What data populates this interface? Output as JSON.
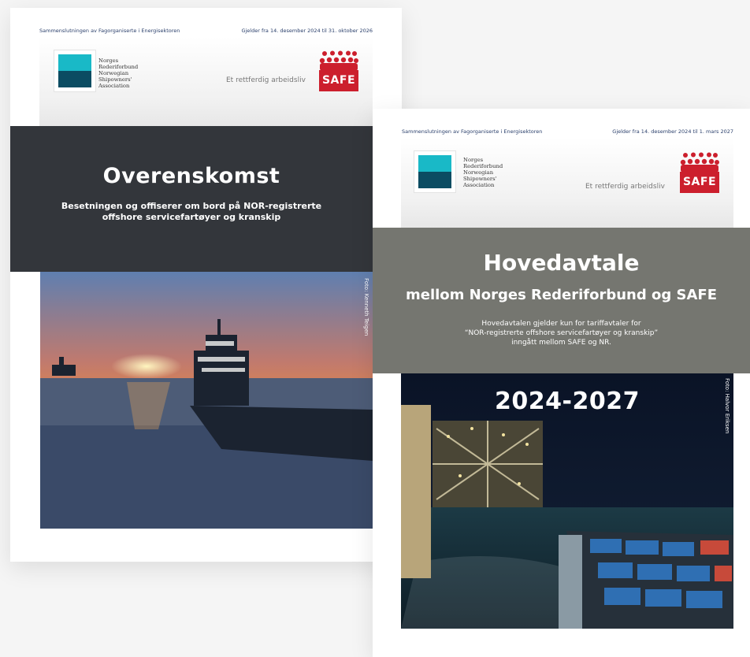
{
  "doc1": {
    "org": "Sammenslutningen av Fagorganiserte i Energisektoren",
    "validity": "Gjelder fra 14. desember 2024 til 31. oktober 2026",
    "nr_logo_text": [
      "Norges",
      "Rederiforbund",
      "Norwegian",
      "Shipowners'",
      "Association"
    ],
    "slogan": "Et rettferdig arbeidsliv",
    "safe_label": "SAFE",
    "title": "Overenskomst",
    "subtitle_line1": "Besetningen og offiserer om bord på NOR-registrerte",
    "subtitle_line2": "offshore servicefartøyer og kranskip",
    "photo_credit": "Foto: Kenneth Teigen"
  },
  "doc2": {
    "org": "Sammenslutningen av Fagorganiserte i Energisektoren",
    "validity": "Gjelder fra 14. desember 2024 til 1. mars 2027",
    "nr_logo_text": [
      "Norges",
      "Rederiforbund",
      "Norwegian",
      "Shipowners'",
      "Association"
    ],
    "slogan": "Et rettferdig arbeidsliv",
    "safe_label": "SAFE",
    "title": "Hovedavtale",
    "subtitle": "mellom Norges Rederiforbund og SAFE",
    "note_line1": "Hovedavtalen gjelder kun for tariffavtaler for",
    "note_line2": "“NOR-registrerte offshore servicefartøyer og kranskip”",
    "note_line3": "inngått mellom SAFE og NR.",
    "years": "2024-2027",
    "photo_credit": "Foto: Halvor Eriksen"
  },
  "colors": {
    "band_dark": "#33363b",
    "band_grey": "#757670",
    "nr_teal": "#19b9c7",
    "nr_navy": "#0b4c62",
    "safe_red": "#cc1f2d"
  }
}
